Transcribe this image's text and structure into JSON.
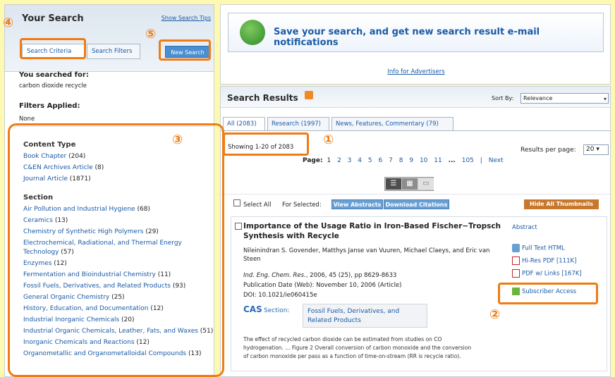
{
  "left": {
    "title": "Your Search",
    "show_tips": "Show Search Tips",
    "tabs": [
      "Search Criteria",
      "Search Filters"
    ],
    "new_search": "New Search",
    "you_searched_label": "You searched for:",
    "query": "carbon dioxide recycle",
    "filters_label": "Filters Applied:",
    "filters_value": "None",
    "content_type_title": "Content Type",
    "content_types": [
      {
        "label": "Book Chapter",
        "count": " (204)"
      },
      {
        "label": "C&EN Archives Article",
        "count": " (8)"
      },
      {
        "label": "Journal Article",
        "count": " (1871)"
      }
    ],
    "section_title": "Section",
    "sections": [
      {
        "label": "Air Pollution and Industrial Hygiene",
        "count": " (68)"
      },
      {
        "label": "Ceramics",
        "count": " (13)"
      },
      {
        "label": "Chemistry of Synthetic High Polymers",
        "count": " (29)"
      },
      {
        "label": "Electrochemical, Radiational, and Thermal Energy Technology",
        "count": " (57)"
      },
      {
        "label": "Enzymes",
        "count": " (12)"
      },
      {
        "label": "Fermentation and Bioindustrial Chemistry",
        "count": " (11)"
      },
      {
        "label": "Fossil Fuels, Derivatives, and Related Products",
        "count": " (93)"
      },
      {
        "label": "General Organic Chemistry",
        "count": " (25)"
      },
      {
        "label": "History, Education, and Documentation",
        "count": " (12)"
      },
      {
        "label": "Industrial Inorganic Chemicals",
        "count": " (20)"
      },
      {
        "label": "Industrial Organic Chemicals, Leather, Fats, and Waxes",
        "count": " (51)"
      },
      {
        "label": "Inorganic Chemicals and Reactions",
        "count": " (12)"
      },
      {
        "label": "Organometallic and Organometalloidal Compounds",
        "count": " (13)"
      }
    ]
  },
  "banner": {
    "text": "Save your search, and get new search result e-mail notifications",
    "advertisers": "Info for Advertisers"
  },
  "results": {
    "title": "Search Results",
    "sort_label": "Sort By:",
    "sort_value": "Relevance",
    "tabs": [
      "All (2083)",
      "Research (1997)",
      "News, Features, Commentary (79)"
    ],
    "showing": "Showing 1-20 of 2083",
    "rpp_label": "Results per page:",
    "rpp_value": "20",
    "pager_label": "Page:",
    "pages": [
      "1",
      "2",
      "3",
      "4",
      "5",
      "6",
      "7",
      "8",
      "9",
      "10",
      "11",
      "...",
      "105",
      "|",
      "Next"
    ],
    "select_all": "Select All",
    "for_selected": "For Selected:",
    "view_abstracts": "View Abstracts",
    "download_citations": "Download Citations",
    "hide_thumbnails": "Hide All Thumbnails",
    "item": {
      "title": "Importance of the Usage Ratio in Iron-Based Fischer−Tropsch Synthesis with Recycle",
      "authors": "Nileinindran S. Govender, Matthys Janse van Vuuren, Michael Claeys, and Eric van Steen",
      "journal": "Ind. Eng. Chem. Res.",
      "journal_rest": ", 2006, 45 (25), pp 8629-8633",
      "pubdate": "Publication Date (Web): November 10, 2006 (Article)",
      "doi": "DOI: 10.1021/ie060415e",
      "cas_logo": "CAS",
      "cas_section_label": "Section:",
      "section_value": "Fossil Fuels, Derivatives, and Related Products",
      "snippet_1": "The effect of recycled carbon dioxide can be estimated from studies on CO",
      "snippet_2": "hydrogenation. ... Figure 2 Overall conversion of carbon monoxide and the conversion",
      "snippet_3": "of carbon monoxide per pass as a function of time-on-stream (RR is recycle ratio).",
      "abstract": "Abstract",
      "full_text_html": "Full Text HTML",
      "hires_pdf": "Hi-Res PDF [111K]",
      "pdf_links": "PDF w/ Links [167K]",
      "subscriber": "Subscriber Access"
    }
  },
  "annotations": {
    "labels": [
      "①",
      "②",
      "③",
      "④",
      "⑤"
    ],
    "color": "#f07b12"
  }
}
